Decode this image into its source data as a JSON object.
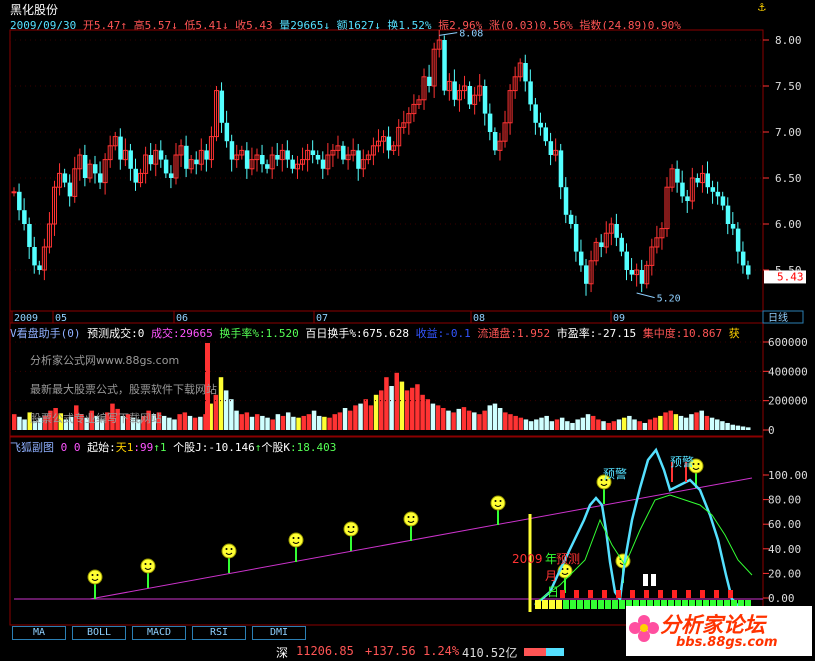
{
  "header": {
    "stock_name": "黑化股份",
    "anchor_icon": "anchor-icon",
    "date": "2009/09/30",
    "open": "开5.47",
    "high": "高5.57",
    "low": "低5.41",
    "close": "收5.43",
    "volume": "量29665",
    "amount": "额1627",
    "turnover": "换1.52%",
    "amplitude": "振2.96%",
    "change": "涨(0.03)0.56%",
    "index": "指数(24.89)0.90%"
  },
  "price_pane": {
    "y_ticks": [
      "8.00",
      "7.50",
      "7.00",
      "6.50",
      "6.00",
      "5.50"
    ],
    "current_price": "5.43",
    "high_label": "8.08",
    "low_label": "5.20",
    "x_labels": [
      "2009",
      "05",
      "06",
      "07",
      "08",
      "09"
    ],
    "period_button": "日线",
    "colors": {
      "up": "#ff3333",
      "down": "#54ffff"
    }
  },
  "volume_pane": {
    "title": "V看盘助手(0)",
    "predict": "预测成交:0",
    "volume": "成交:29665",
    "turnover": "换手率%:1.520",
    "hundred_day": "百日换手%:675.628",
    "profit": "收益:-0.1",
    "float_cap": "流通盘:1.952",
    "pe": "市盈率:-27.15",
    "concentration": "集中度:10.867",
    "extra": "获",
    "y_ticks": [
      "600000",
      "400000",
      "200000",
      "0"
    ],
    "watermark1": "分析家公式网www.88gs.com",
    "watermark2": "最新最大股票公式，股票软件下载网站",
    "watermark3": "股票公式专业编写下载网站"
  },
  "indicator_pane": {
    "title": "飞狐副图",
    "params": "0 0",
    "start_label": "起始:",
    "day1": "天1",
    "day1_value": ":99",
    "arrow1": "↑1",
    "stock_j": "个股J",
    "stock_j_value": ":-10.146",
    "stock_k": "个股K",
    "stock_k_value": ":18.403",
    "y_ticks": [
      "100.00",
      "80.00",
      "60.00",
      "40.00",
      "20.00",
      "0.00"
    ],
    "warn1": "预警",
    "warn2": "预警",
    "year_label_num": "2009",
    "year_label_char": "年",
    "predict_label": "预测",
    "month_label": "月",
    "day_label": "日"
  },
  "tabs": [
    "MA",
    "BOLL",
    "MACD",
    "RSI",
    "DMI"
  ],
  "statusbar": {
    "market": "深",
    "index_value": "11206.85",
    "index_change": "+137.56",
    "index_pct": "1.24%",
    "amount": "410.52亿"
  },
  "logo": {
    "title": "分析家论坛",
    "url": "bbs.88gs.com"
  }
}
